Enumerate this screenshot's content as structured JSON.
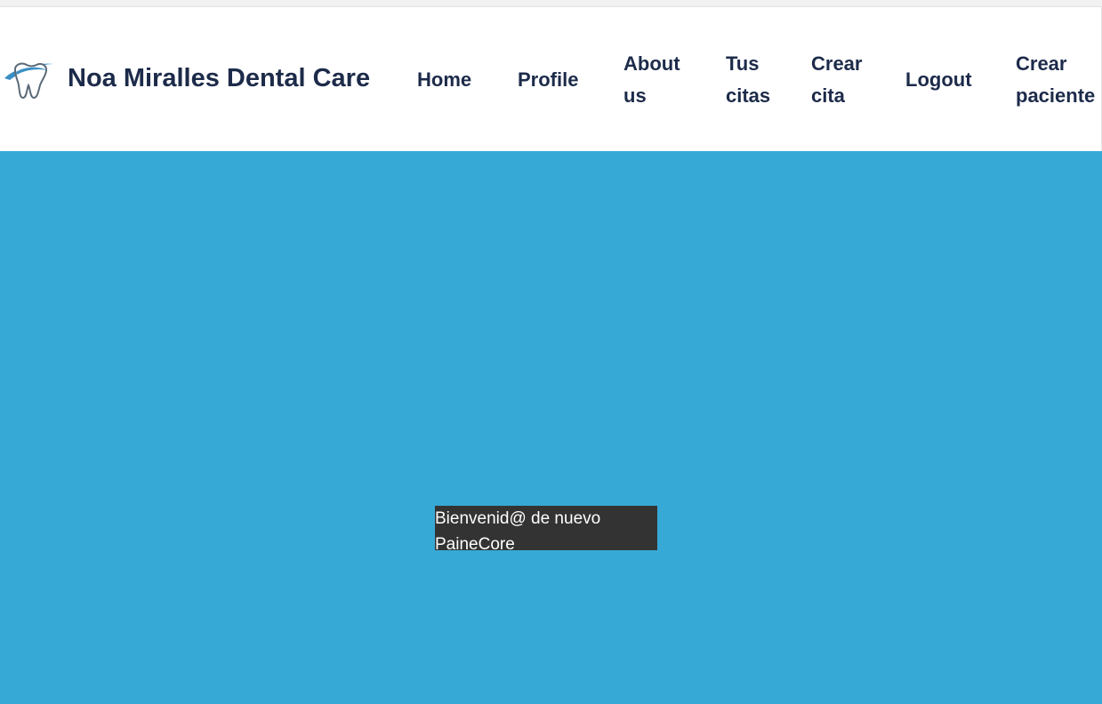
{
  "brand": {
    "name": "Noa Miralles Dental Care",
    "logo_icon": "tooth-logo-icon"
  },
  "nav": {
    "home": "Home",
    "profile": "Profile",
    "about_line1": "About",
    "about_line2": "us",
    "tus_citas_line1": "Tus",
    "tus_citas_line2": "citas",
    "crear_cita_line1": "Crear",
    "crear_cita_line2": "cita",
    "logout": "Logout",
    "crear_paciente_line1": "Crear",
    "crear_paciente_line2": "paciente"
  },
  "welcome": {
    "line1": "Bienvenid@ de nuevo",
    "line2": "PaineCore"
  },
  "colors": {
    "background": "#37a9d6",
    "navbar": "#ffffff",
    "nav_text": "#1d2b4a",
    "welcome_box": "#333333",
    "logo_blue": "#3a8fc4"
  }
}
